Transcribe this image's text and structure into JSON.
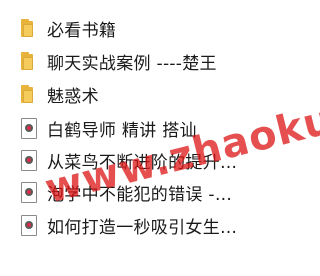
{
  "items": [
    {
      "type": "folder",
      "label": "必看书籍"
    },
    {
      "type": "folder",
      "label": "聊天实战案例 ----楚王"
    },
    {
      "type": "folder",
      "label": "魅惑术"
    },
    {
      "type": "video",
      "label": "白鹤导师 精讲   搭讪"
    },
    {
      "type": "video",
      "label": "从菜鸟不断进阶的提升…"
    },
    {
      "type": "video",
      "label": "泡学中不能犯的错误 -…"
    },
    {
      "type": "video",
      "label": "如何打造一秒吸引女生…"
    }
  ],
  "watermark": "www.zhaoku.com"
}
